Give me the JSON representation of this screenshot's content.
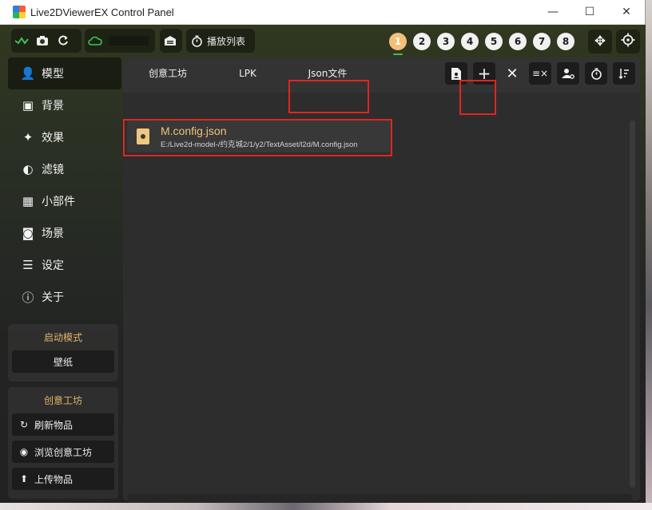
{
  "window": {
    "title": "Live2DViewerEX Control Panel",
    "controls": {
      "minimize": "—",
      "maximize": "☐",
      "close": "✕"
    }
  },
  "toolbar": {
    "playlist_label": "播放列表",
    "number_buttons": [
      "1",
      "2",
      "3",
      "4",
      "5",
      "6",
      "7",
      "8"
    ],
    "active_number": "1",
    "icons": [
      "wave-icon",
      "camera-icon",
      "refresh-icon",
      "cloud-icon",
      "garage-icon",
      "timer-icon",
      "move-icon",
      "target-icon"
    ]
  },
  "sidebar": {
    "items": [
      {
        "label": "模型",
        "icon": "person-gear-icon",
        "active": true
      },
      {
        "label": "背景",
        "icon": "image-person-icon"
      },
      {
        "label": "效果",
        "icon": "sparkle-icon"
      },
      {
        "label": "滤镜",
        "icon": "contrast-icon"
      },
      {
        "label": "小部件",
        "icon": "widgets-icon"
      },
      {
        "label": "场景",
        "icon": "camera-icon"
      },
      {
        "label": "设定",
        "icon": "sliders-icon"
      },
      {
        "label": "关于",
        "icon": "info-icon"
      }
    ],
    "launch_mode": {
      "title": "启动模式",
      "value": "壁纸"
    },
    "workshop": {
      "title": "创意工坊",
      "buttons": [
        {
          "label": "刷新物品",
          "icon": "refresh-icon"
        },
        {
          "label": "浏览创意工坊",
          "icon": "eye-icon"
        },
        {
          "label": "上传物品",
          "icon": "upload-icon"
        }
      ]
    }
  },
  "main": {
    "tabs": [
      {
        "label": "创意工坊"
      },
      {
        "label": "LPK"
      },
      {
        "label": "Json文件",
        "active": true
      }
    ],
    "actions": [
      "file-person-icon",
      "plus-icon",
      "close-icon",
      "clear-list-icon",
      "person-settings-icon",
      "timer-icon",
      "sort-icon"
    ],
    "files": [
      {
        "name": "M.config.json",
        "path": "E:/Live2d-model-/约克城2/1/y2/TextAsset/l2d/M.config.json"
      }
    ]
  },
  "colors": {
    "accent": "#f0c681",
    "highlight": "#e0261e",
    "active_number": "#f3c07a"
  }
}
